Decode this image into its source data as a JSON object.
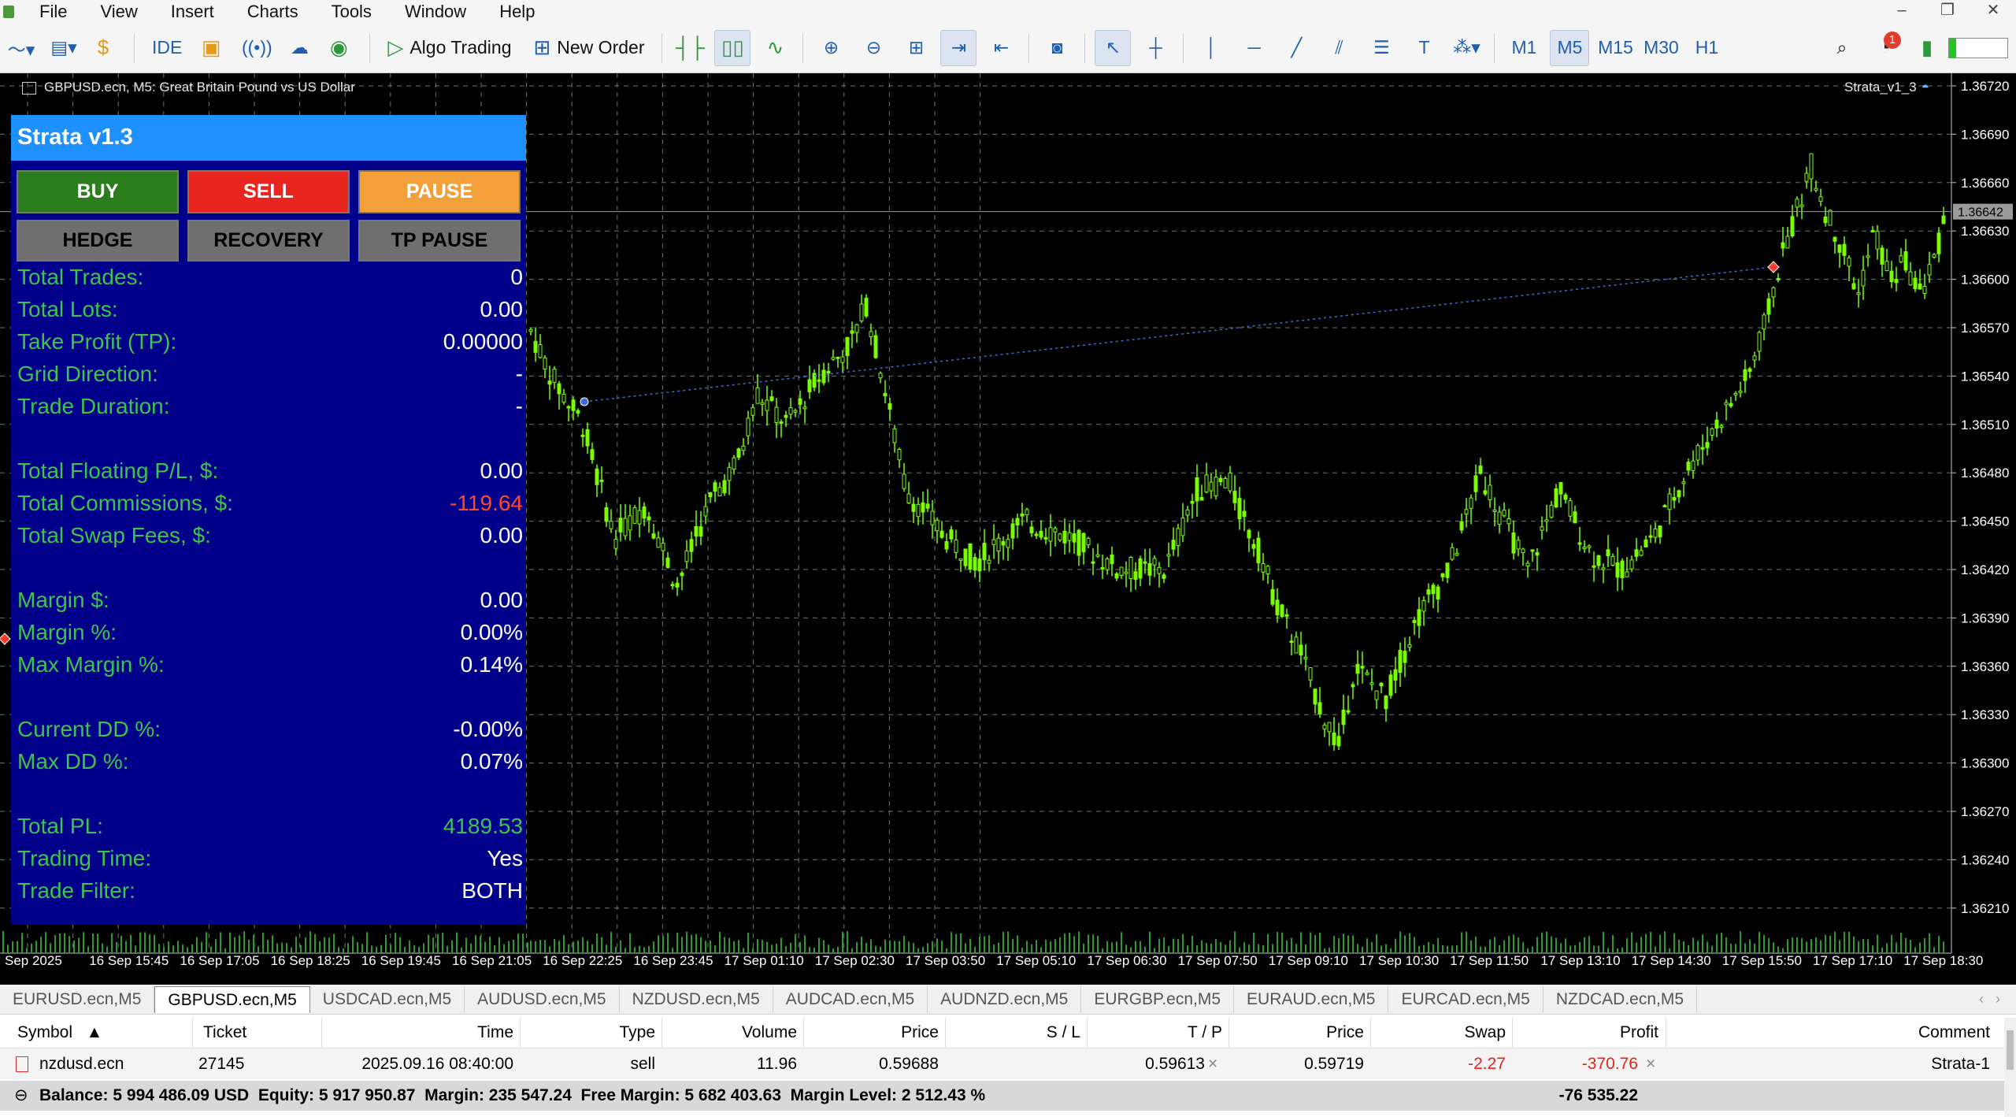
{
  "menu": [
    "File",
    "View",
    "Insert",
    "Charts",
    "Tools",
    "Window",
    "Help"
  ],
  "window_controls": [
    "–",
    "❐",
    "✕"
  ],
  "toolbar": {
    "ide_label": "IDE",
    "algo_trading_label": "Algo Trading",
    "new_order_label": "New Order",
    "timeframes": [
      "M1",
      "M5",
      "M15",
      "M30",
      "H1"
    ],
    "active_timeframe": "M5",
    "notification_count": "1"
  },
  "chart": {
    "title": "GBPUSD.ecn, M5: Great Britain Pound vs US Dollar",
    "ea_name": "Strata_v1_3",
    "background": "#000000",
    "candle_color": "#7CFC00",
    "grid_color": "#6a7a6a",
    "current_price": "1.36642",
    "price_ticks": [
      "1.36720",
      "1.36690",
      "1.36660",
      "1.36630",
      "1.36600",
      "1.36570",
      "1.36540",
      "1.36510",
      "1.36480",
      "1.36450",
      "1.36420",
      "1.36390",
      "1.36360",
      "1.36330",
      "1.36300",
      "1.36270",
      "1.36240",
      "1.36210"
    ],
    "time_ticks": [
      "Sep 2025",
      "16 Sep 15:45",
      "16 Sep 17:05",
      "16 Sep 18:25",
      "16 Sep 19:45",
      "16 Sep 21:05",
      "16 Sep 22:25",
      "16 Sep 23:45",
      "17 Sep 01:10",
      "17 Sep 02:30",
      "17 Sep 03:50",
      "17 Sep 05:10",
      "17 Sep 06:30",
      "17 Sep 07:50",
      "17 Sep 09:10",
      "17 Sep 10:30",
      "17 Sep 11:50",
      "17 Sep 13:10",
      "17 Sep 14:30",
      "17 Sep 15:50",
      "17 Sep 17:10",
      "17 Sep 18:30"
    ]
  },
  "ea_panel": {
    "title": "Strata v1.3",
    "buttons_row1": [
      "BUY",
      "SELL",
      "PAUSE"
    ],
    "buttons_row2": [
      "HEDGE",
      "RECOVERY",
      "TP PAUSE"
    ],
    "stats": [
      {
        "label": "Total Trades:",
        "value": "0",
        "color": "white"
      },
      {
        "label": "Total Lots:",
        "value": "0.00",
        "color": "white"
      },
      {
        "label": "Take Profit (TP):",
        "value": "0.00000",
        "color": "white"
      },
      {
        "label": "Grid Direction:",
        "value": "-",
        "color": "white"
      },
      {
        "label": "Trade Duration:",
        "value": "-",
        "color": "white"
      },
      {
        "label": "Total Floating P/L, $:",
        "value": "0.00",
        "color": "white"
      },
      {
        "label": "Total Commissions, $:",
        "value": "-119.64",
        "color": "red"
      },
      {
        "label": "Total Swap Fees, $:",
        "value": "0.00",
        "color": "white"
      },
      {
        "label": "Margin $:",
        "value": "0.00",
        "color": "white"
      },
      {
        "label": "Margin %:",
        "value": "0.00%",
        "color": "white"
      },
      {
        "label": "Max Margin %:",
        "value": "0.14%",
        "color": "white"
      },
      {
        "label": "Current DD %:",
        "value": "-0.00%",
        "color": "white"
      },
      {
        "label": "Max DD %:",
        "value": "0.07%",
        "color": "white"
      },
      {
        "label": "Total PL:",
        "value": "4189.53",
        "color": "green"
      },
      {
        "label": "Trading Time:",
        "value": "Yes",
        "color": "white"
      },
      {
        "label": "Trade Filter:",
        "value": "BOTH",
        "color": "white"
      }
    ]
  },
  "symbol_tabs": [
    "EURUSD.ecn,M5",
    "GBPUSD.ecn,M5",
    "USDCAD.ecn,M5",
    "AUDUSD.ecn,M5",
    "NZDUSD.ecn,M5",
    "AUDCAD.ecn,M5",
    "AUDNZD.ecn,M5",
    "EURGBP.ecn,M5",
    "EURAUD.ecn,M5",
    "EURCAD.ecn,M5",
    "NZDCAD.ecn,M5"
  ],
  "active_symbol_tab": "GBPUSD.ecn,M5",
  "trade_table": {
    "headers": [
      "Symbol",
      "Ticket",
      "Time",
      "Type",
      "Volume",
      "Price",
      "S / L",
      "T / P",
      "Price",
      "Swap",
      "Profit",
      "Comment"
    ],
    "sort_indicator": "▲",
    "rows": [
      {
        "symbol": "nzdusd.ecn",
        "ticket": "27145",
        "time": "2025.09.16 08:40:00",
        "type": "sell",
        "volume": "11.96",
        "price": "0.59688",
        "sl": "",
        "tp": "0.59613",
        "price_now": "0.59719",
        "swap": "-2.27",
        "profit": "-370.76",
        "comment": "Strata-1"
      }
    ],
    "summary": "Balance: 5 994 486.09 USD  Equity: 5 917 950.87  Margin: 235 547.24  Free Margin: 5 682 403.63  Margin Level: 2 512.43 %",
    "summary_profit": "-76 535.22",
    "close_mark": "×"
  }
}
